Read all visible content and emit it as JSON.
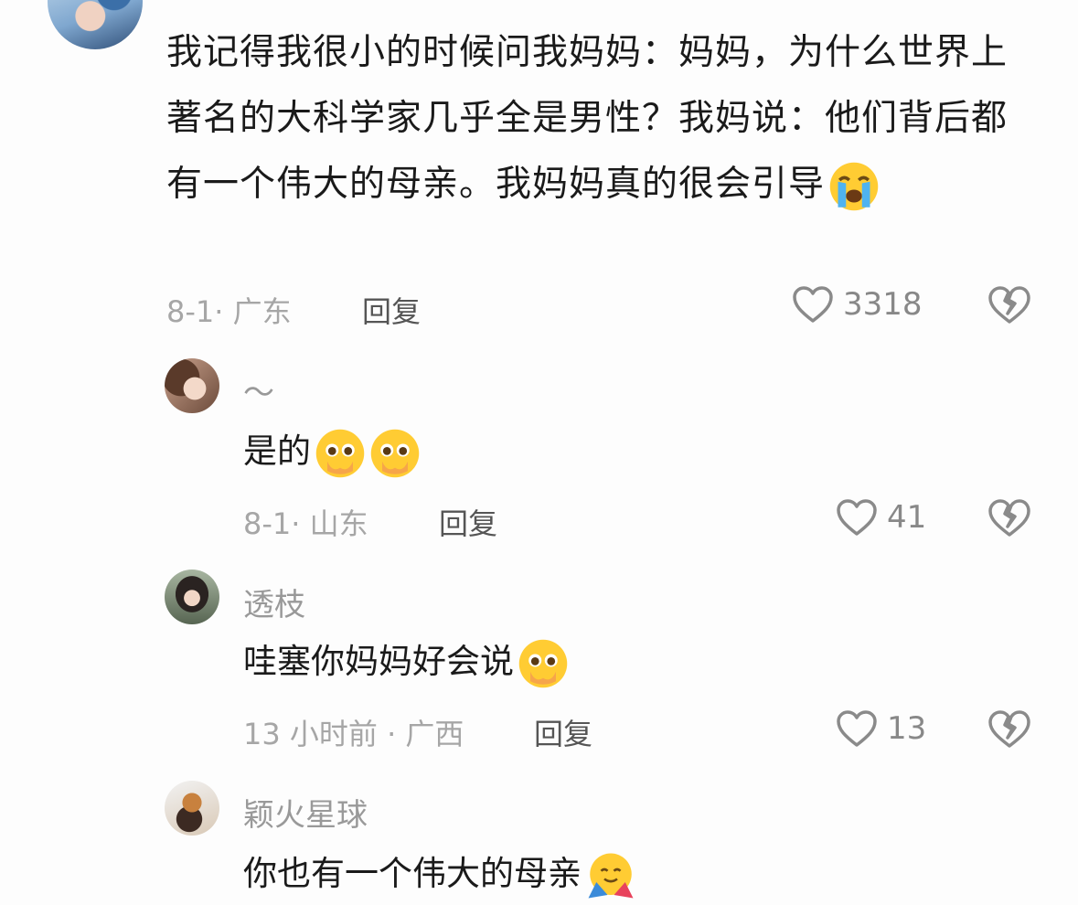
{
  "comments": [
    {
      "text": "我记得我很小的时候问我妈妈：妈妈，为什么世界上著名的大科学家几乎全是男性？我妈说：他们背后都有一个伟大的母亲。我妈妈真的很会引导",
      "emoji": "loudly-crying-face",
      "meta": "8-1· 广东",
      "reply_label": "回复",
      "likes": "3318"
    }
  ],
  "replies": [
    {
      "username": "～",
      "text": "是的",
      "emojis": [
        "pleading-face-holding-back-tears",
        "pleading-face-holding-back-tears"
      ],
      "meta": "8-1· 山东",
      "reply_label": "回复",
      "likes": "41"
    },
    {
      "username": "透枝",
      "text": "哇塞你妈妈好会说",
      "emojis": [
        "pleading-face-holding-back-tears"
      ],
      "meta": "13 小时前 · 广西",
      "reply_label": "回复",
      "likes": "13"
    },
    {
      "username": "颖火星球",
      "text": "你也有一个伟大的母亲",
      "emojis": [
        "smiling-face-with-open-hands"
      ],
      "meta": "",
      "reply_label": "",
      "likes": ""
    }
  ],
  "icons": {
    "like": "heart-outline-icon",
    "dislike": "broken-heart-icon"
  },
  "colors": {
    "meta_gray": "#a6a6a6",
    "username_gray": "#999999",
    "text": "#1a1a1a"
  }
}
